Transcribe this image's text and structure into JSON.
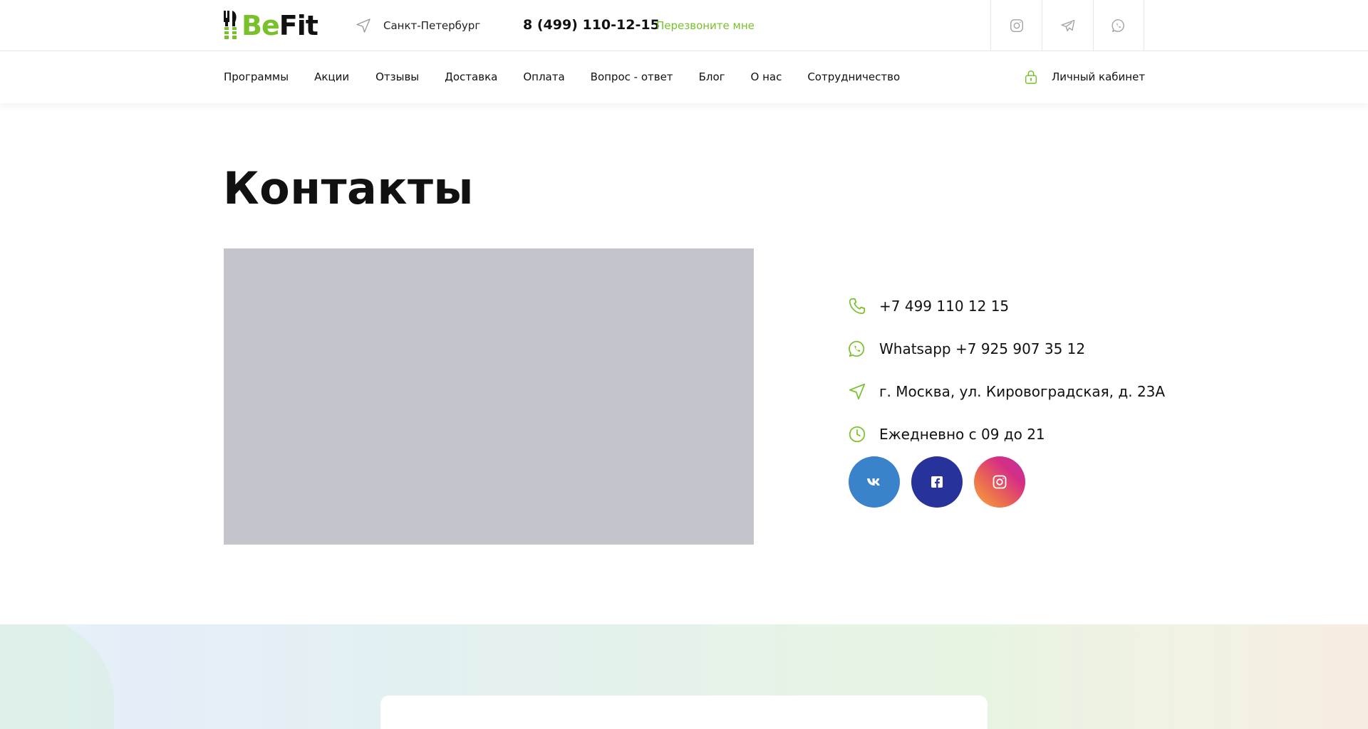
{
  "brand": {
    "logo_be": "Be",
    "logo_fit": "Fit",
    "accent_color": "#79c12b"
  },
  "header": {
    "city": "Санкт-Петербург",
    "phone": "8 (499) 110-12-15",
    "callback_label": "Перезвоните мне",
    "socials": [
      "instagram-icon",
      "telegram-icon",
      "whatsapp-icon"
    ]
  },
  "nav": {
    "items": [
      {
        "label": "Программы"
      },
      {
        "label": "Акции"
      },
      {
        "label": "Отзывы"
      },
      {
        "label": "Доставка"
      },
      {
        "label": "Оплата"
      },
      {
        "label": "Вопрос - ответ"
      },
      {
        "label": "Блог"
      },
      {
        "label": "О нас"
      },
      {
        "label": "Сотрудничество"
      }
    ],
    "cabinet_label": "Личный кабинет"
  },
  "page": {
    "title": "Контакты"
  },
  "contacts": {
    "phone": "+7 499 110 12 15",
    "whatsapp": "Whatsapp +7 925 907 35 12",
    "address": "г. Москва, ул. Кировоградская, д. 23А",
    "hours": "Ежедневно с 09 до 21"
  },
  "social_links": [
    {
      "icon": "vk-icon",
      "color": "#3a82c9"
    },
    {
      "icon": "facebook-icon",
      "color": "#28329b"
    },
    {
      "icon": "instagram-icon",
      "color": "#d52f83"
    }
  ]
}
